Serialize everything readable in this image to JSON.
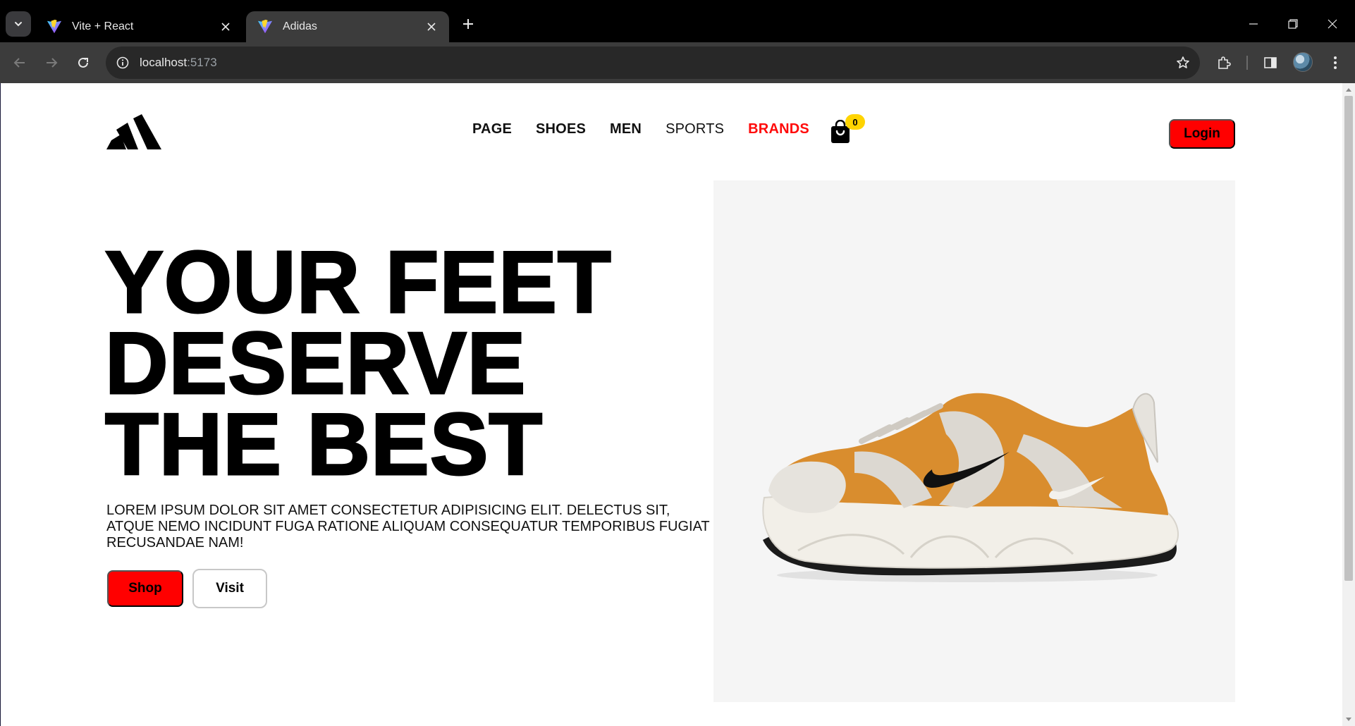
{
  "browser": {
    "tabs": [
      {
        "title": "Vite + React",
        "active": false
      },
      {
        "title": "Adidas",
        "active": true
      }
    ],
    "url": {
      "host": "localhost",
      "port": ":5173"
    }
  },
  "page": {
    "nav": {
      "items": [
        {
          "label": "PAGE"
        },
        {
          "label": "SHOES"
        },
        {
          "label": "MEN"
        },
        {
          "label": "SPORTS"
        },
        {
          "label": "BRANDS"
        }
      ],
      "cart_count": "0",
      "login_label": "Login"
    },
    "hero": {
      "headline": [
        "YOUR FEET",
        "DESERVE",
        "THE BEST"
      ],
      "description": "LOREM IPSUM DOLOR SIT AMET CONSECTETUR ADIPISICING ELIT. DELECTUS SIT, ATQUE NEMO INCIDUNT FUGA RATIONE ALIQUAM CONSEQUATUR TEMPORIBUS FUGIAT RECUSANDAE NAM!",
      "shop_label": "Shop",
      "visit_label": "Visit",
      "image": "sneaker-image"
    }
  },
  "colors": {
    "accent": "#ff0000",
    "brands_link": "#ff0a0a",
    "badge": "#ffd400",
    "hero_card_bg": "#f5f5f5"
  }
}
